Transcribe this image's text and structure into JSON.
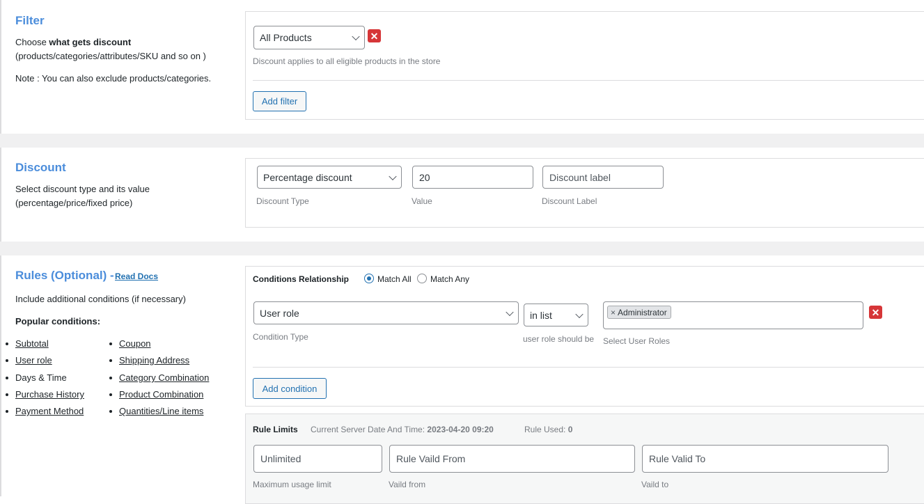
{
  "filter": {
    "heading": "Filter",
    "desc_prefix": "Choose ",
    "desc_bold": "what gets discount",
    "desc_line2": "(products/categories/attributes/SKU and so on )",
    "note": "Note : You can also exclude products/categories.",
    "select_value": "All Products",
    "hint": "Discount applies to all eligible products in the store",
    "add_button": "Add filter",
    "remove_icon": "close-icon"
  },
  "discount": {
    "heading": "Discount",
    "desc_line1": "Select discount type and its value",
    "desc_line2": "(percentage/price/fixed price)",
    "type_value": "Percentage discount",
    "type_label": "Discount Type",
    "value": "20",
    "value_label": "Value",
    "label_placeholder": "Discount label",
    "label_label": "Discount Label"
  },
  "rules": {
    "heading": "Rules (Optional) -",
    "read_docs": "Read Docs",
    "desc": "Include additional conditions (if necessary)",
    "popular_title": "Popular conditions:",
    "popular_left": [
      "Subtotal",
      "User role",
      "Days & Time",
      "Purchase History",
      "Payment Method"
    ],
    "popular_right": [
      "Coupon",
      "Shipping Address",
      "Category Combination",
      "Product Combination",
      "Quantities/Line items"
    ],
    "relationship_label": "Conditions Relationship",
    "match_all": "Match All",
    "match_any": "Match Any",
    "condition_type_value": "User role",
    "condition_type_label": "Condition Type",
    "operator_value": "in list",
    "operator_label": "user role should be",
    "tag_remove": "×",
    "tag_value": "Administrator",
    "roles_label": "Select User Roles",
    "add_condition": "Add condition"
  },
  "limits": {
    "title": "Rule Limits",
    "server_time_label": "Current Server Date And Time:",
    "server_time_value": "2023-04-20 09:20",
    "rule_used_label": "Rule Used:",
    "rule_used_value": "0",
    "max_usage_placeholder": "Unlimited",
    "max_usage_label": "Maximum usage limit",
    "valid_from_placeholder": "Rule Vaild From",
    "valid_from_label": "Vaild from",
    "valid_to_placeholder": "Rule Valid To",
    "valid_to_label": "Vaild to"
  },
  "colors": {
    "heading": "#4b8ddb",
    "accent": "#2271b1",
    "danger": "#d63638",
    "band": "#f0f0f1"
  }
}
